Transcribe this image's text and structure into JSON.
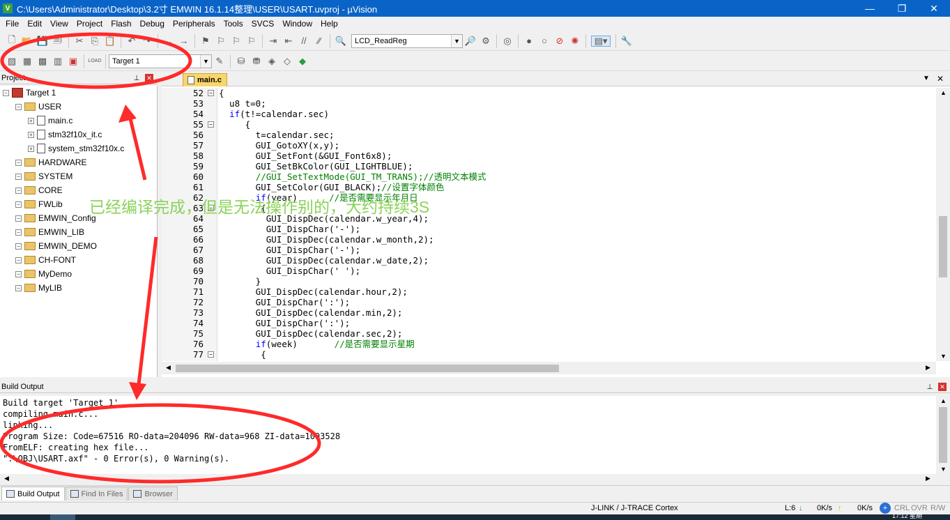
{
  "window": {
    "title": "C:\\Users\\Administrator\\Desktop\\3.2寸 EMWIN 16.1.14整理\\USER\\USART.uvproj - µVision",
    "minimize": "—",
    "maximize": "❐",
    "close": "✕"
  },
  "menu": [
    "File",
    "Edit",
    "View",
    "Project",
    "Flash",
    "Debug",
    "Peripherals",
    "Tools",
    "SVCS",
    "Window",
    "Help"
  ],
  "toolbar": {
    "function_combo": "LCD_ReadReg",
    "target_combo": "Target 1",
    "load_label": "LOAD"
  },
  "project_panel": {
    "title": "Project",
    "tree": [
      {
        "label": "Target 1",
        "kind": "target",
        "level": 0
      },
      {
        "label": "USER",
        "kind": "folder",
        "level": 1
      },
      {
        "label": "main.c",
        "kind": "file",
        "level": 2
      },
      {
        "label": "stm32f10x_it.c",
        "kind": "file",
        "level": 2
      },
      {
        "label": "system_stm32f10x.c",
        "kind": "file",
        "level": 2
      },
      {
        "label": "HARDWARE",
        "kind": "folder",
        "level": 1
      },
      {
        "label": "SYSTEM",
        "kind": "folder",
        "level": 1
      },
      {
        "label": "CORE",
        "kind": "folder",
        "level": 1
      },
      {
        "label": "FWLib",
        "kind": "folder",
        "level": 1
      },
      {
        "label": "EMWIN_Config",
        "kind": "folder",
        "level": 1
      },
      {
        "label": "EMWIN_LIB",
        "kind": "folder",
        "level": 1
      },
      {
        "label": "EMWIN_DEMO",
        "kind": "folder",
        "level": 1
      },
      {
        "label": "CH-FONT",
        "kind": "folder",
        "level": 1
      },
      {
        "label": "MyDemo",
        "kind": "folder",
        "level": 1
      },
      {
        "label": "MyLIB",
        "kind": "folder",
        "level": 1
      }
    ]
  },
  "editor": {
    "tab": "main.c",
    "lines": [
      {
        "n": "52",
        "fold": "⊟",
        "code": "{"
      },
      {
        "n": "53",
        "fold": "",
        "code": "  u8 t=0;"
      },
      {
        "n": "54",
        "fold": "",
        "code": "  if(t!=calendar.sec)"
      },
      {
        "n": "55",
        "fold": "⊟",
        "code": "     {"
      },
      {
        "n": "56",
        "fold": "",
        "code": "       t=calendar.sec;"
      },
      {
        "n": "57",
        "fold": "",
        "code": "       GUI_GotoXY(x,y);"
      },
      {
        "n": "58",
        "fold": "",
        "code": "       GUI_SetFont(&GUI_Font6x8);"
      },
      {
        "n": "59",
        "fold": "",
        "code": "       GUI_SetBkColor(GUI_LIGHTBLUE);"
      },
      {
        "n": "60",
        "fold": "",
        "code": "       //GUI_SetTextMode(GUI_TM_TRANS);//透明文本模式"
      },
      {
        "n": "61",
        "fold": "",
        "code": "       GUI_SetColor(GUI_BLACK);//设置字体颜色"
      },
      {
        "n": "62",
        "fold": "",
        "code": "       if(year)      //是否需要显示年月日"
      },
      {
        "n": "63",
        "fold": "⊟",
        "code": "        {"
      },
      {
        "n": "64",
        "fold": "",
        "code": "         GUI_DispDec(calendar.w_year,4);"
      },
      {
        "n": "65",
        "fold": "",
        "code": "         GUI_DispChar('-');"
      },
      {
        "n": "66",
        "fold": "",
        "code": "         GUI_DispDec(calendar.w_month,2);"
      },
      {
        "n": "67",
        "fold": "",
        "code": "         GUI_DispChar('-');"
      },
      {
        "n": "68",
        "fold": "",
        "code": "         GUI_DispDec(calendar.w_date,2);"
      },
      {
        "n": "69",
        "fold": "",
        "code": "         GUI_DispChar(' ');"
      },
      {
        "n": "70",
        "fold": "",
        "code": "       }"
      },
      {
        "n": "71",
        "fold": "",
        "code": "       GUI_DispDec(calendar.hour,2);"
      },
      {
        "n": "72",
        "fold": "",
        "code": "       GUI_DispChar(':');"
      },
      {
        "n": "73",
        "fold": "",
        "code": "       GUI_DispDec(calendar.min,2);"
      },
      {
        "n": "74",
        "fold": "",
        "code": "       GUI_DispChar(':');"
      },
      {
        "n": "75",
        "fold": "",
        "code": "       GUI_DispDec(calendar.sec,2);"
      },
      {
        "n": "76",
        "fold": "",
        "code": "       if(week)       //是否需要显示星期"
      },
      {
        "n": "77",
        "fold": "⊟",
        "code": "        {"
      }
    ]
  },
  "build_output": {
    "title": "Build Output",
    "lines": [
      "Build target 'Target 1'",
      "compiling main.c...",
      "linking...",
      "Program Size: Code=67516 RO-data=204096 RW-data=968 ZI-data=1093528",
      "FromELF: creating hex file...",
      "\".\\OBJ\\USART.axf\" - 0 Error(s), 0 Warning(s)."
    ]
  },
  "bottom_tabs": [
    "Build Output",
    "Find In Files",
    "Browser"
  ],
  "status": {
    "debugger": "J-LINK / J-TRACE Cortex",
    "pos": "L:6",
    "down": "0K/s",
    "up": "0K/s",
    "caps": "CRL",
    "ovr": "OVR",
    "rw": "R/W",
    "time": "17:12 星期"
  },
  "annotation": "已经编译完成，但是无法操作别的，大约持续3S",
  "colors": {
    "titlebar": "#0a64c8",
    "keyword": "#0000ff",
    "comment": "#008000",
    "annotation": "#8bd35a",
    "ellipse": "#ff2a2a"
  }
}
